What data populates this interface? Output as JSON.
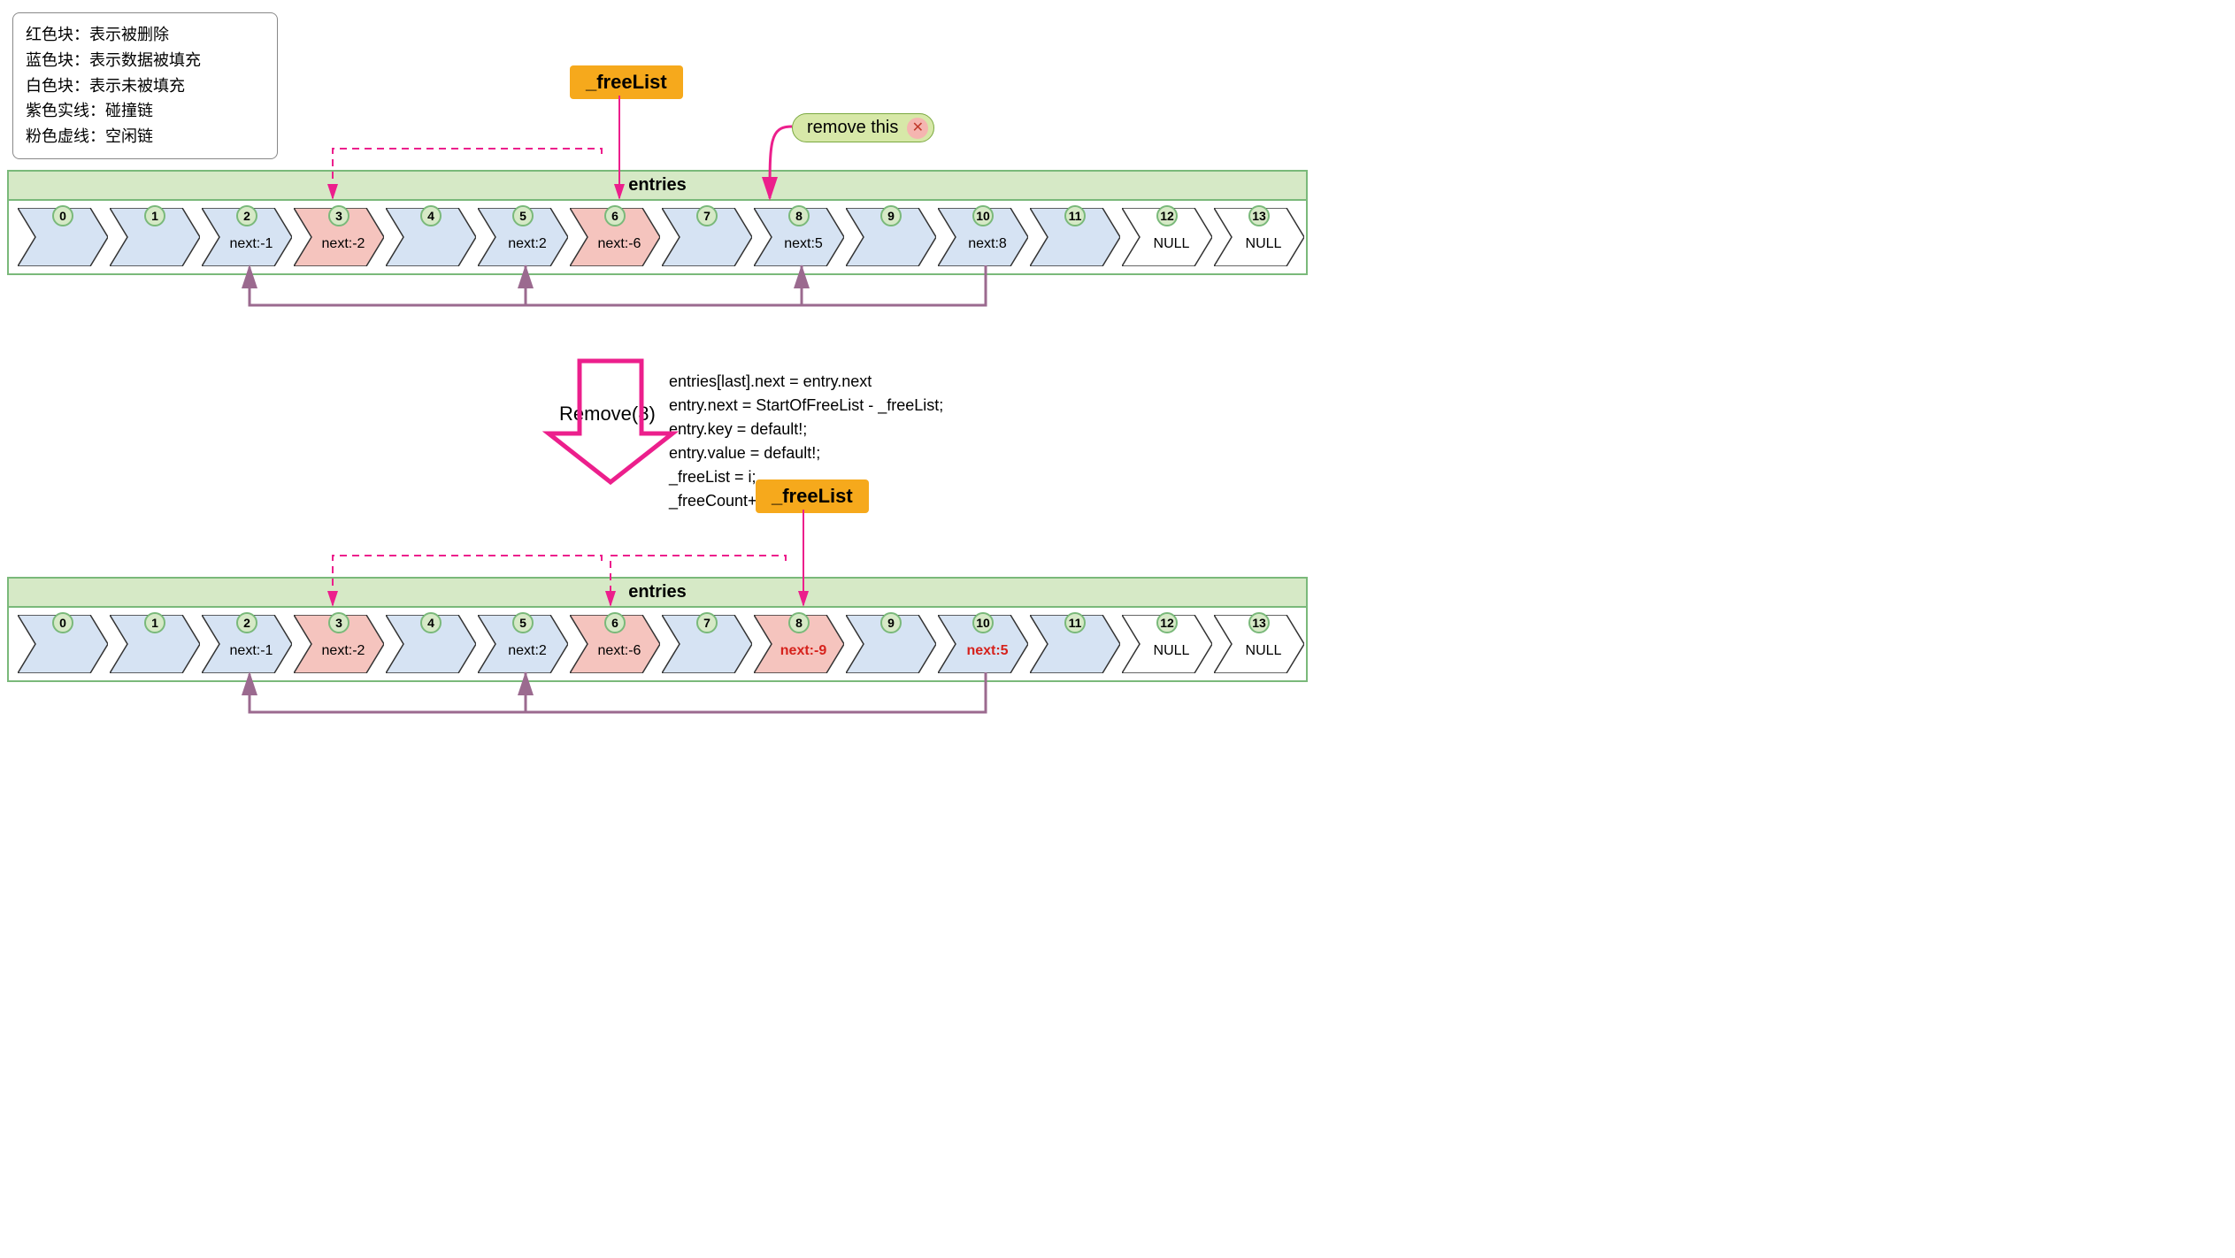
{
  "legend": {
    "l1": "红色块：表示被删除",
    "l2": "蓝色块：表示数据被填充",
    "l3": "白色块：表示未被填充",
    "l4": "紫色实线：碰撞链",
    "l5": "粉色虚线：空闲链"
  },
  "labels": {
    "freelist": "_freeList",
    "entries": "entries",
    "remove_this": "remove this",
    "remove_op": "Remove(8)"
  },
  "code": "entries[last].next = entry.next\nentry.next = StartOfFreeList - _freeList;\nentry.key = default!;\nentry.value = default!;\n_freeList = i;\n_freeCount++;",
  "top": {
    "cells": [
      {
        "idx": "0",
        "label": "",
        "fill": "#d6e3f3"
      },
      {
        "idx": "1",
        "label": "",
        "fill": "#d6e3f3"
      },
      {
        "idx": "2",
        "label": "next:-1",
        "fill": "#d6e3f3"
      },
      {
        "idx": "3",
        "label": "next:-2",
        "fill": "#f5c4be"
      },
      {
        "idx": "4",
        "label": "",
        "fill": "#d6e3f3"
      },
      {
        "idx": "5",
        "label": "next:2",
        "fill": "#d6e3f3"
      },
      {
        "idx": "6",
        "label": "next:-6",
        "fill": "#f5c4be"
      },
      {
        "idx": "7",
        "label": "",
        "fill": "#d6e3f3"
      },
      {
        "idx": "8",
        "label": "next:5",
        "fill": "#d6e3f3"
      },
      {
        "idx": "9",
        "label": "",
        "fill": "#d6e3f3"
      },
      {
        "idx": "10",
        "label": "next:8",
        "fill": "#d6e3f3"
      },
      {
        "idx": "11",
        "label": "",
        "fill": "#d6e3f3"
      },
      {
        "idx": "12",
        "label": "NULL",
        "fill": "#ffffff"
      },
      {
        "idx": "13",
        "label": "NULL",
        "fill": "#ffffff"
      }
    ]
  },
  "bottom": {
    "cells": [
      {
        "idx": "0",
        "label": "",
        "fill": "#d6e3f3"
      },
      {
        "idx": "1",
        "label": "",
        "fill": "#d6e3f3"
      },
      {
        "idx": "2",
        "label": "next:-1",
        "fill": "#d6e3f3"
      },
      {
        "idx": "3",
        "label": "next:-2",
        "fill": "#f5c4be"
      },
      {
        "idx": "4",
        "label": "",
        "fill": "#d6e3f3"
      },
      {
        "idx": "5",
        "label": "next:2",
        "fill": "#d6e3f3"
      },
      {
        "idx": "6",
        "label": "next:-6",
        "fill": "#f5c4be"
      },
      {
        "idx": "7",
        "label": "",
        "fill": "#d6e3f3"
      },
      {
        "idx": "8",
        "label": "next:-9",
        "fill": "#f5c4be",
        "red": true
      },
      {
        "idx": "9",
        "label": "",
        "fill": "#d6e3f3"
      },
      {
        "idx": "10",
        "label": "next:5",
        "fill": "#d6e3f3",
        "red": true
      },
      {
        "idx": "11",
        "label": "",
        "fill": "#d6e3f3"
      },
      {
        "idx": "12",
        "label": "NULL",
        "fill": "#ffffff"
      },
      {
        "idx": "13",
        "label": "NULL",
        "fill": "#ffffff"
      }
    ]
  },
  "colors": {
    "pink": "#ec1f8c",
    "purple": "#9b6a8f",
    "green_border": "#7ab97a"
  }
}
